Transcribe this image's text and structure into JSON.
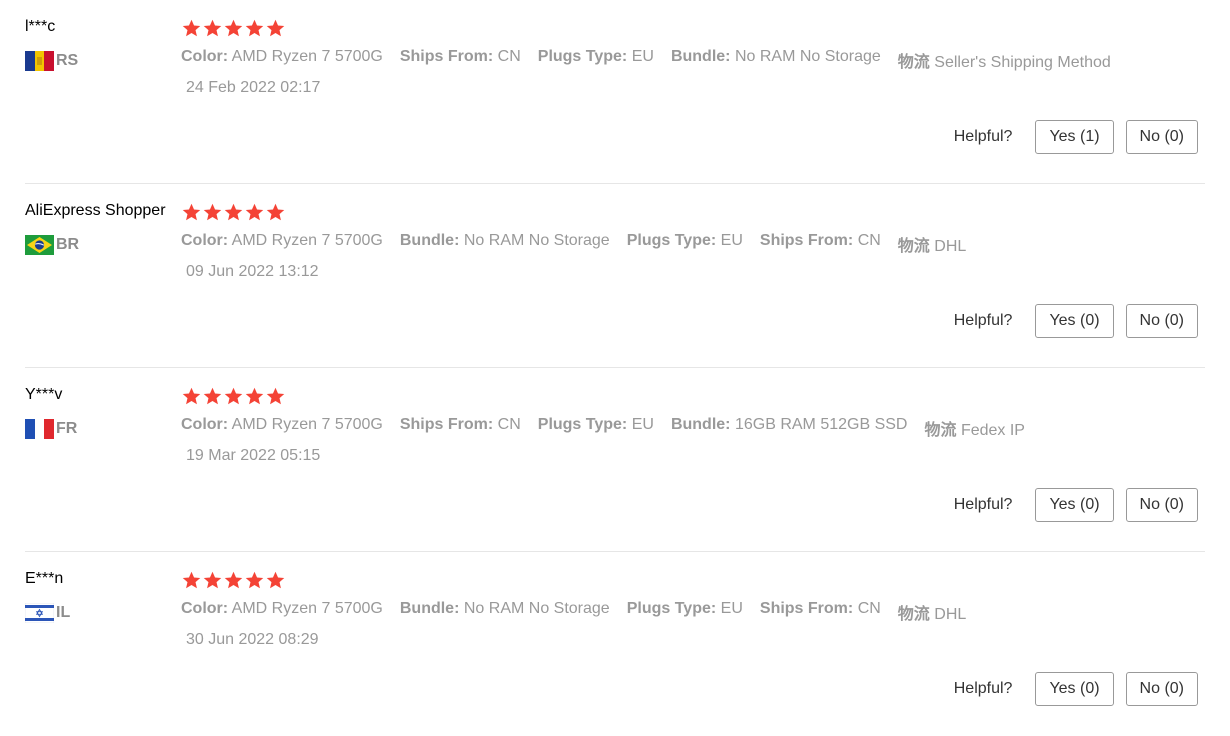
{
  "colors": {
    "star": "#f44336",
    "muted_text": "#999999",
    "divider": "#e6e6e6"
  },
  "reviews": [
    {
      "user": "l***c",
      "country": "RS",
      "flag": "flag-rs-icon",
      "rating": 5,
      "sku": [
        {
          "key": "Color:",
          "value": "AMD Ryzen 7 5700G"
        },
        {
          "key": "Ships From:",
          "value": "CN"
        },
        {
          "key": "Plugs Type:",
          "value": "EU"
        },
        {
          "key": "Bundle:",
          "value": "No RAM No Storage"
        },
        {
          "key": "物流",
          "value": "Seller's Shipping Method"
        }
      ],
      "date": "24 Feb 2022 02:17",
      "helpful_label": "Helpful?",
      "yes_label": "Yes (1)",
      "no_label": "No (0)"
    },
    {
      "user": "AliExpress Shopper",
      "country": "BR",
      "flag": "flag-br-icon",
      "rating": 5,
      "sku": [
        {
          "key": "Color:",
          "value": "AMD Ryzen 7 5700G"
        },
        {
          "key": "Bundle:",
          "value": "No RAM No Storage"
        },
        {
          "key": "Plugs Type:",
          "value": "EU"
        },
        {
          "key": "Ships From:",
          "value": "CN"
        },
        {
          "key": "物流",
          "value": "DHL"
        }
      ],
      "date": "09 Jun 2022 13:12",
      "helpful_label": "Helpful?",
      "yes_label": "Yes (0)",
      "no_label": "No (0)"
    },
    {
      "user": "Y***v",
      "country": "FR",
      "flag": "flag-fr-icon",
      "rating": 5,
      "sku": [
        {
          "key": "Color:",
          "value": "AMD Ryzen 7 5700G"
        },
        {
          "key": "Ships From:",
          "value": "CN"
        },
        {
          "key": "Plugs Type:",
          "value": "EU"
        },
        {
          "key": "Bundle:",
          "value": "16GB RAM 512GB SSD"
        },
        {
          "key": "物流",
          "value": "Fedex IP"
        }
      ],
      "date": "19 Mar 2022 05:15",
      "helpful_label": "Helpful?",
      "yes_label": "Yes (0)",
      "no_label": "No (0)"
    },
    {
      "user": "E***n",
      "country": "IL",
      "flag": "flag-il-icon",
      "rating": 5,
      "sku": [
        {
          "key": "Color:",
          "value": "AMD Ryzen 7 5700G"
        },
        {
          "key": "Bundle:",
          "value": "No RAM No Storage"
        },
        {
          "key": "Plugs Type:",
          "value": "EU"
        },
        {
          "key": "Ships From:",
          "value": "CN"
        },
        {
          "key": "物流",
          "value": "DHL"
        }
      ],
      "date": "30 Jun 2022 08:29",
      "helpful_label": "Helpful?",
      "yes_label": "Yes (0)",
      "no_label": "No (0)"
    }
  ]
}
